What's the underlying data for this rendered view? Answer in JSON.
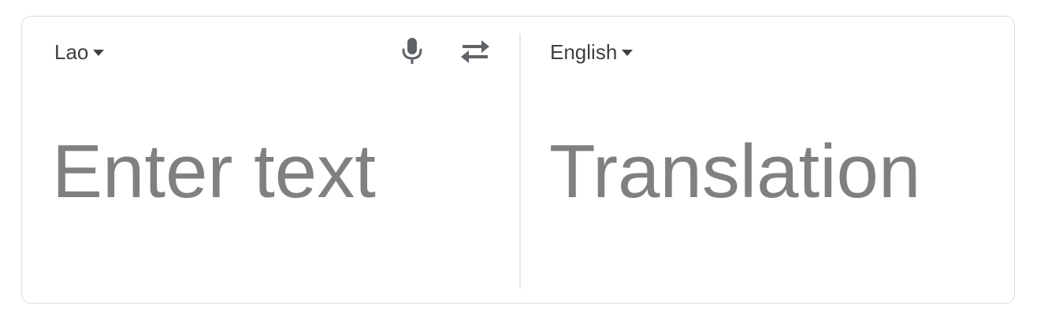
{
  "source": {
    "language": "Lao",
    "placeholder": "Enter text"
  },
  "target": {
    "language": "English",
    "placeholder": "Translation"
  },
  "icons": {
    "mic": "microphone-icon",
    "swap": "swap-languages-icon",
    "caret": "caret-down-icon"
  },
  "colors": {
    "placeholder": "#808080",
    "label": "#3c4043",
    "icon": "#5f6368",
    "border": "#dadce0"
  }
}
